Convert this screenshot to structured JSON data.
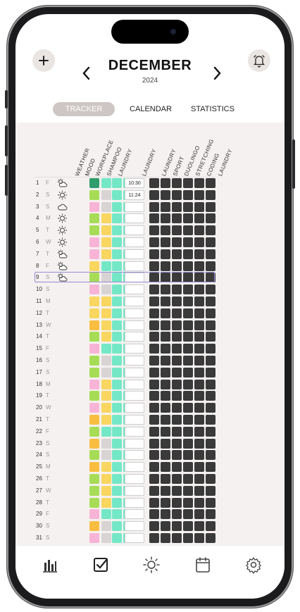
{
  "header": {
    "add_icon": "plus-icon",
    "alarm_icon": "alarm-bell-icon",
    "month": "DECEMBER",
    "year": "2024",
    "prev_icon": "chevron-left-icon",
    "next_icon": "chevron-right-icon"
  },
  "tabs": [
    {
      "label": "TRACKER",
      "active": true
    },
    {
      "label": "CALENDAR",
      "active": false
    },
    {
      "label": "STATISTICS",
      "active": false
    }
  ],
  "columns": [
    "WEATHER",
    "MOOD",
    "WORKPLACE",
    "SHAMPOO",
    "LAUNDRY",
    "LAUNDRY",
    "LAUNDRY",
    "SPORT",
    "DUOLINGO",
    "STRETCHING",
    "CODING",
    "LAUNDRY",
    "SHAMPOO"
  ],
  "colors": {
    "mint": "#74e8c6",
    "green": "#a7dc56",
    "darkgreen": "#2f9d6c",
    "yellow": "#f8d660",
    "orange": "#f9bd40",
    "pink": "#f8b4d6",
    "gray": "#d7d4d3",
    "dark": "#3a3a3a",
    "selection": "#9c8ad6"
  },
  "days": [
    {
      "day": "1",
      "dow": "F",
      "weather": "partly-cloudy",
      "mood": "darkgreen",
      "work": "mint",
      "time": "10:30"
    },
    {
      "day": "2",
      "dow": "S",
      "weather": "sun",
      "mood": "green",
      "work": "gray",
      "time": "11:24"
    },
    {
      "day": "3",
      "dow": "S",
      "weather": "cloud",
      "mood": "pink",
      "work": "gray",
      "time": ""
    },
    {
      "day": "4",
      "dow": "M",
      "weather": "sun",
      "mood": "green",
      "work": "yellow",
      "time": ""
    },
    {
      "day": "5",
      "dow": "T",
      "weather": "sun",
      "mood": "green",
      "work": "yellow",
      "time": ""
    },
    {
      "day": "6",
      "dow": "W",
      "weather": "sun",
      "mood": "pink",
      "work": "yellow",
      "time": ""
    },
    {
      "day": "7",
      "dow": "T",
      "weather": "partly-cloudy",
      "mood": "pink",
      "work": "yellow",
      "time": ""
    },
    {
      "day": "8",
      "dow": "F",
      "weather": "partly-cloudy",
      "mood": "yellow",
      "work": "mint",
      "time": ""
    },
    {
      "day": "9",
      "dow": "S",
      "weather": "partly-cloudy",
      "mood": "green",
      "work": "gray",
      "time": ""
    },
    {
      "day": "10",
      "dow": "S",
      "weather": "",
      "mood": "pink",
      "work": "gray",
      "time": ""
    },
    {
      "day": "11",
      "dow": "M",
      "weather": "",
      "mood": "yellow",
      "work": "yellow",
      "time": ""
    },
    {
      "day": "12",
      "dow": "T",
      "weather": "",
      "mood": "yellow",
      "work": "yellow",
      "time": ""
    },
    {
      "day": "13",
      "dow": "W",
      "weather": "",
      "mood": "orange",
      "work": "yellow",
      "time": ""
    },
    {
      "day": "14",
      "dow": "T",
      "weather": "",
      "mood": "green",
      "work": "yellow",
      "time": ""
    },
    {
      "day": "15",
      "dow": "F",
      "weather": "",
      "mood": "pink",
      "work": "mint",
      "time": ""
    },
    {
      "day": "16",
      "dow": "S",
      "weather": "",
      "mood": "green",
      "work": "gray",
      "time": ""
    },
    {
      "day": "17",
      "dow": "S",
      "weather": "",
      "mood": "green",
      "work": "gray",
      "time": ""
    },
    {
      "day": "18",
      "dow": "M",
      "weather": "",
      "mood": "pink",
      "work": "yellow",
      "time": ""
    },
    {
      "day": "19",
      "dow": "T",
      "weather": "",
      "mood": "green",
      "work": "yellow",
      "time": ""
    },
    {
      "day": "20",
      "dow": "W",
      "weather": "",
      "mood": "pink",
      "work": "yellow",
      "time": ""
    },
    {
      "day": "21",
      "dow": "T",
      "weather": "",
      "mood": "orange",
      "work": "yellow",
      "time": ""
    },
    {
      "day": "22",
      "dow": "F",
      "weather": "",
      "mood": "green",
      "work": "mint",
      "time": ""
    },
    {
      "day": "23",
      "dow": "S",
      "weather": "",
      "mood": "orange",
      "work": "gray",
      "time": ""
    },
    {
      "day": "24",
      "dow": "S",
      "weather": "",
      "mood": "green",
      "work": "gray",
      "time": ""
    },
    {
      "day": "25",
      "dow": "M",
      "weather": "",
      "mood": "orange",
      "work": "yellow",
      "time": ""
    },
    {
      "day": "26",
      "dow": "T",
      "weather": "",
      "mood": "green",
      "work": "yellow",
      "time": ""
    },
    {
      "day": "27",
      "dow": "W",
      "weather": "",
      "mood": "green",
      "work": "yellow",
      "time": ""
    },
    {
      "day": "28",
      "dow": "T",
      "weather": "",
      "mood": "green",
      "work": "yellow",
      "time": ""
    },
    {
      "day": "29",
      "dow": "F",
      "weather": "",
      "mood": "pink",
      "work": "mint",
      "time": ""
    },
    {
      "day": "30",
      "dow": "S",
      "weather": "",
      "mood": "orange",
      "work": "gray",
      "time": ""
    },
    {
      "day": "31",
      "dow": "S",
      "weather": "",
      "mood": "pink",
      "work": "gray",
      "time": ""
    }
  ],
  "selected_day": "9",
  "tabbar": [
    {
      "icon": "bar-chart-icon"
    },
    {
      "icon": "checkbox-icon"
    },
    {
      "icon": "sun-icon"
    },
    {
      "icon": "calendar-icon"
    },
    {
      "icon": "gear-icon"
    }
  ]
}
